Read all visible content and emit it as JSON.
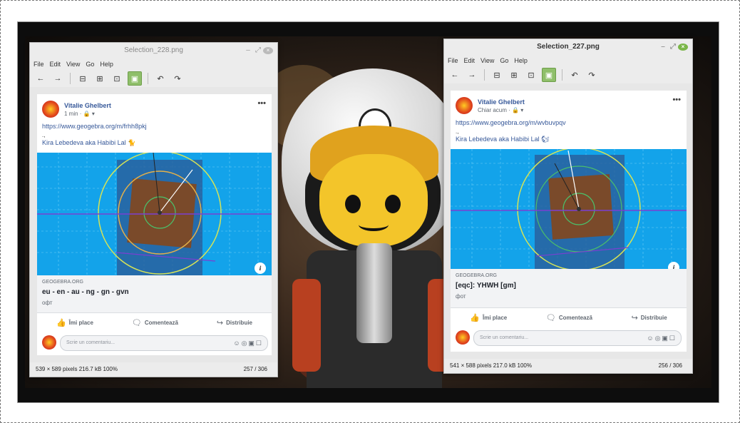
{
  "windows": [
    {
      "id": "left",
      "title": "Selection_228.png",
      "menu": [
        "File",
        "Edit",
        "View",
        "Go",
        "Help"
      ],
      "post": {
        "author": "Vitalie Ghelbert",
        "meta": "1 min · 🔒 ▾",
        "link": "https://www.geogebra.org/m/frhh8pkj",
        "dots": ".,",
        "mention": "Kira Lebedeva aka Habibi Lal 🐈",
        "source": "GEOGEBRA.ORG",
        "preview_title": "eu - en - au - ng - gn - gvn",
        "preview_desc": "офт",
        "like": "Îmi place",
        "comment": "Comentează",
        "share": "Distribuie",
        "comment_placeholder": "Scrie un comentariu..."
      },
      "status": {
        "info": "539 × 589 pixels  216.7 kB   100%",
        "page": "257 / 306"
      }
    },
    {
      "id": "right",
      "title": "Selection_227.png",
      "menu": [
        "File",
        "Edit",
        "View",
        "Go",
        "Help"
      ],
      "post": {
        "author": "Vitalie Ghelbert",
        "meta": "Chiar acum · 🔒 ▾",
        "link": "https://www.geogebra.org/m/wvbuvpqv",
        "dots": ".,",
        "mention": "Kira Lebedeva aka Habibi Lal 🐿",
        "source": "GEOGEBRA.ORG",
        "preview_title": "[eqc]: YHWH [gm]",
        "preview_desc": "фот",
        "like": "Îmi place",
        "comment": "Comentează",
        "share": "Distribuie",
        "comment_placeholder": "Scrie un comentariu..."
      },
      "status": {
        "info": "541 × 588 pixels  217.0 kB   100%",
        "page": "256 / 306"
      }
    }
  ],
  "toolbar_icons": [
    "back-arrow-icon",
    "forward-arrow-icon",
    "zoom-out-icon",
    "zoom-in-icon",
    "zoom-normal-icon",
    "best-fit-icon",
    "rotate-left-icon",
    "rotate-right-icon"
  ],
  "colors": {
    "accent": "#7ab648",
    "fb_link": "#365899",
    "geogebra_bg": "#13a3ea"
  }
}
